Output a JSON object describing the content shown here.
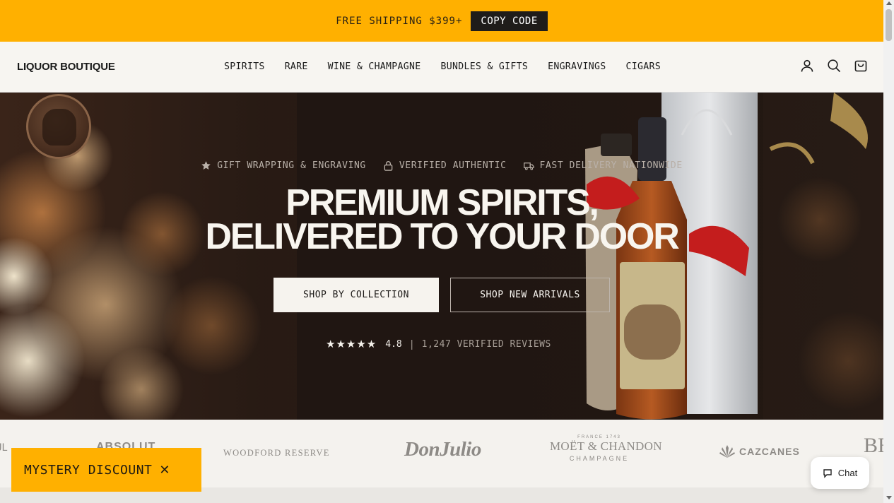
{
  "announcement": {
    "text": "FREE SHIPPING $399+",
    "copy_label": "COPY CODE"
  },
  "header": {
    "logo": "LIQUOR BOUTIQUE",
    "nav": [
      "SPIRITS",
      "RARE",
      "WINE & CHAMPAGNE",
      "BUNDLES & GIFTS",
      "ENGRAVINGS",
      "CIGARS"
    ],
    "icons": [
      "account-icon",
      "search-icon",
      "cart-icon"
    ]
  },
  "hero": {
    "features": [
      {
        "icon": "star-icon",
        "label": "GIFT WRAPPING & ENGRAVING"
      },
      {
        "icon": "lock-icon",
        "label": "VERIFIED AUTHENTIC"
      },
      {
        "icon": "truck-icon",
        "label": "FAST DELIVERY NATIONWIDE"
      }
    ],
    "headline_line1": "PREMIUM SPIRITS,",
    "headline_line2": "DELIVERED TO YOUR DOOR",
    "cta_primary": "SHOP BY COLLECTION",
    "cta_secondary": "SHOP NEW ARRIVALS",
    "rating": {
      "stars": "★★★★★",
      "score": "4.8",
      "separator": "|",
      "reviews": "1,247 VERIFIED REVIEWS"
    }
  },
  "brands": {
    "cut_left": "UL",
    "absolut": "ABSOLUT",
    "woodford": "WOODFORD RESERVE",
    "donjulio": "DonJulio",
    "moet_small": "FRANCE 1743",
    "moet_main": "MOËT & CHANDON",
    "moet_sub": "CHAMPAGNE",
    "cazcanes": "CAZCANES",
    "cut_right": "BE"
  },
  "popup": {
    "mystery_label": "MYSTERY DISCOUNT",
    "mystery_close": "✕"
  },
  "chat": {
    "label": "Chat"
  },
  "colors": {
    "accent": "#ffb000",
    "dark": "#1f1c1a",
    "cream": "#f6f3ee"
  }
}
